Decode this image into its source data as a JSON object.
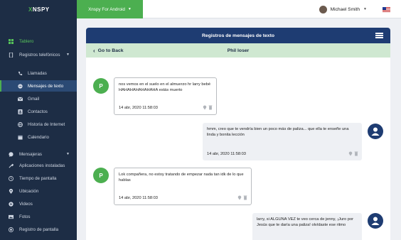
{
  "brand": {
    "prefix": "X",
    "name": "NSPY"
  },
  "header": {
    "device_label": "Xnspy For Android",
    "user_name": "Michael Smith"
  },
  "sidebar": {
    "items": [
      {
        "label": "Tablero",
        "icon": "dashboard-icon"
      },
      {
        "label": "Registros telefónicos",
        "icon": "phone-icon"
      },
      {
        "label": "Llamadas",
        "icon": "call-icon"
      },
      {
        "label": "Mensajes de texto",
        "icon": "message-icon"
      },
      {
        "label": "Gmail",
        "icon": "gmail-icon"
      },
      {
        "label": "Contactos",
        "icon": "contacts-icon"
      },
      {
        "label": "Historia de Internet",
        "icon": "globe-icon"
      },
      {
        "label": "Calendario",
        "icon": "calendar-icon"
      },
      {
        "label": "Mensajeras",
        "icon": "chat-icon"
      },
      {
        "label": "Aplicaciones instaladas",
        "icon": "apps-icon"
      },
      {
        "label": "Tiempo de pantalla",
        "icon": "clock-icon"
      },
      {
        "label": "Ubicación",
        "icon": "location-icon"
      },
      {
        "label": "Videos",
        "icon": "video-icon"
      },
      {
        "label": "Fotos",
        "icon": "photo-icon"
      },
      {
        "label": "Registro de pantalla",
        "icon": "record-icon"
      }
    ]
  },
  "panel": {
    "title": "Registros de mensajes de texto",
    "back_label": "Go to Back",
    "contact_name": "Phil loser"
  },
  "messages": [
    {
      "direction": "incoming",
      "avatar": "P",
      "text": "nos vemos en el suelo en el almuerzo hr larry bebé HAHAHAHAHAHAHA estás muerto",
      "time": "14 abr, 2020 11:58:03"
    },
    {
      "direction": "outgoing",
      "avatar": "",
      "text": "hmm, creo que te vendría bien un poco más de paliza... que ella te enseñe una linda y bonita lección",
      "time": "14 abr, 2020 11:58:03"
    },
    {
      "direction": "incoming",
      "avatar": "P",
      "text": "Lok compañera, no estoy tratando de empezar nada tan idk de lo que hablas",
      "time": "14 abr, 2020 11:58:03"
    },
    {
      "direction": "outgoing",
      "avatar": "",
      "text": "larry, si ALGUNA VEZ te veo cerca de jenny, ¡Juro por Jesús que te daría una paliza! olvídaste ese ritmo",
      "time": ""
    }
  ],
  "colors": {
    "sidebar_bg": "#1d2d45",
    "accent_green": "#4caf50",
    "panel_header": "#1e3c72",
    "subheader_bg": "#cfe8d1"
  }
}
